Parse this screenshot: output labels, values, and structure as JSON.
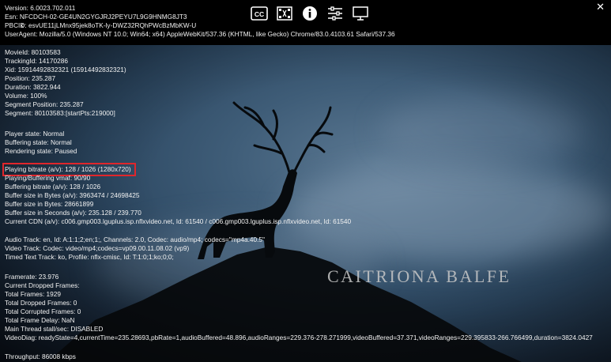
{
  "header": {
    "version": "Version: 6.0023.702.011",
    "esn": "Esn: NFCDCH-02-GE4UN2GYGJRJ2PEYU7L9G9HNMG8JT3",
    "pbcid": "PBCID: esvUE11jLMnx95jek8oTK-ly-DWZ32RQhPWcBzMbKW-U",
    "useragent": "UserAgent: Mozilla/5.0 (Windows NT 10.0; Win64; x64) AppleWebKit/537.36 (KHTML, like Gecko) Chrome/83.0.4103.61 Safari/537.36"
  },
  "icons": [
    "closed-captions-icon",
    "subtitle-settings-icon",
    "info-icon",
    "settings-sliders-icon",
    "display-icon"
  ],
  "close_glyph": "✕",
  "back_glyph": "‹",
  "movie": {
    "movie_id": "MovieId: 80103583",
    "tracking_id": "TrackingId: 14170286",
    "xid": "Xid: 15914492832321 (15914492832321)",
    "position": "Position: 235.287",
    "duration": "Duration: 3822.944",
    "volume": "Volume: 100%",
    "segment_position": "Segment Position: 235.287",
    "segment": "Segment: 80103583:[startPts:219000]"
  },
  "state": {
    "player": "Player state: Normal",
    "buffering": "Buffering state: Normal",
    "rendering": "Rendering state: Paused"
  },
  "bitrate": {
    "playing": "Playing bitrate (a/v): 128 / 1026 (1280x720)",
    "vmaf": "Playing/Buffering vmaf: 90/90",
    "buffering": "Buffering bitrate (a/v): 128 / 1026",
    "buffer_bytes_av": "Buffer size in Bytes (a/v): 3963474 / 24698425",
    "buffer_bytes": "Buffer size in Bytes: 28661899",
    "buffer_seconds": "Buffer size in Seconds (a/v): 235.128 / 239.770",
    "cdn": "Current CDN (a/v): c006.gmp003.lguplus.isp.nflxvideo.net, Id: 61540 / c006.gmp003.lguplus.isp.nflxvideo.net, Id: 61540"
  },
  "tracks": {
    "audio": "Audio Track: en, Id: A:1:1;2;en;1;, Channels: 2.0, Codec: audio/mp4; codecs=\"mp4a.40.5\"",
    "video": "Video Track: Codec: video/mp4;codecs=vp09.00.11.08.02 (vp9)",
    "text": "Timed Text Track: ko, Profile: nflx-cmisc, Id: T:1:0;1;ko;0;0;"
  },
  "frames": {
    "framerate": "Framerate: 23.976",
    "current_dropped": "Current Dropped Frames:",
    "total": "Total Frames: 1929",
    "total_dropped": "Total Dropped Frames: 0",
    "corrupted": "Total Corrupted Frames: 0",
    "delay": "Total Frame Delay: NaN",
    "stall": "Main Thread stall/sec: DISABLED",
    "videodiag": "VideoDiag: readyState=4,currentTime=235.28693,pbRate=1,audioBuffered=48.896,audioRanges=229.376-278.271999,videoBuffered=37.371,videoRanges=229.395833-266.766499,duration=3824.0427"
  },
  "throughput": "Throughput: 86008 kbps",
  "title_card": "CAITRIONA BALFE",
  "colors": {
    "highlight": "#e0262b",
    "text": "#f2f2f2",
    "topbar": "#000000"
  }
}
